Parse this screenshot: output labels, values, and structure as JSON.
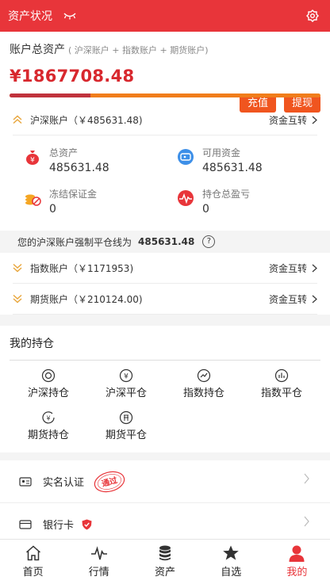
{
  "header": {
    "title": "资产状况",
    "eye_icon": "eye-closed-icon",
    "settings_icon": "gear-icon"
  },
  "summary": {
    "label": "账户总资产",
    "sublabel": "( 沪深账户 + 指数账户 + 期货账户)",
    "total": "¥1867708.48",
    "deposit_label": "充值",
    "withdraw_label": "提现",
    "progress_ratio": 0.26,
    "colors": {
      "accent": "#e8353a",
      "button": "#f0551f"
    }
  },
  "accounts": [
    {
      "name": "沪深账户（￥485631.48)",
      "transfer": "资金互转"
    },
    {
      "name": "指数账户（￥1171953)",
      "transfer": "资金互转"
    },
    {
      "name": "期货账户（￥210124.00)",
      "transfer": "资金互转"
    }
  ],
  "stats": [
    {
      "title": "总资产",
      "value": "485631.48",
      "icon": "money-bag-icon"
    },
    {
      "title": "可用资金",
      "value": "485631.48",
      "icon": "wallet-icon"
    },
    {
      "title": "冻结保证金",
      "value": "0",
      "icon": "frozen-coins-icon"
    },
    {
      "title": "持仓总盈亏",
      "value": "0",
      "icon": "pulse-icon"
    }
  ],
  "warning": {
    "text": "您的沪深账户强制平仓线为",
    "value": "485631.48",
    "help": "?"
  },
  "holdings": {
    "title": "我的持仓",
    "items": [
      {
        "label": "沪深持仓",
        "icon": "coin-circle-icon"
      },
      {
        "label": "沪深平仓",
        "icon": "yen-circle-icon"
      },
      {
        "label": "指数持仓",
        "icon": "trend-circle-icon"
      },
      {
        "label": "指数平仓",
        "icon": "bar-circle-icon"
      },
      {
        "label": "期货持仓",
        "icon": "clock-yen-icon"
      },
      {
        "label": "期货平仓",
        "icon": "qi-circle-icon"
      }
    ]
  },
  "list": [
    {
      "label": "实名认证",
      "icon": "id-card-icon",
      "stamp": "通过"
    },
    {
      "label": "银行卡",
      "icon": "bank-card-icon"
    }
  ],
  "tabs": [
    {
      "label": "首页",
      "icon": "home-icon"
    },
    {
      "label": "行情",
      "icon": "pulse-line-icon"
    },
    {
      "label": "资产",
      "icon": "coins-stack-icon"
    },
    {
      "label": "自选",
      "icon": "star-icon"
    },
    {
      "label": "我的",
      "icon": "user-icon",
      "active": true
    }
  ]
}
